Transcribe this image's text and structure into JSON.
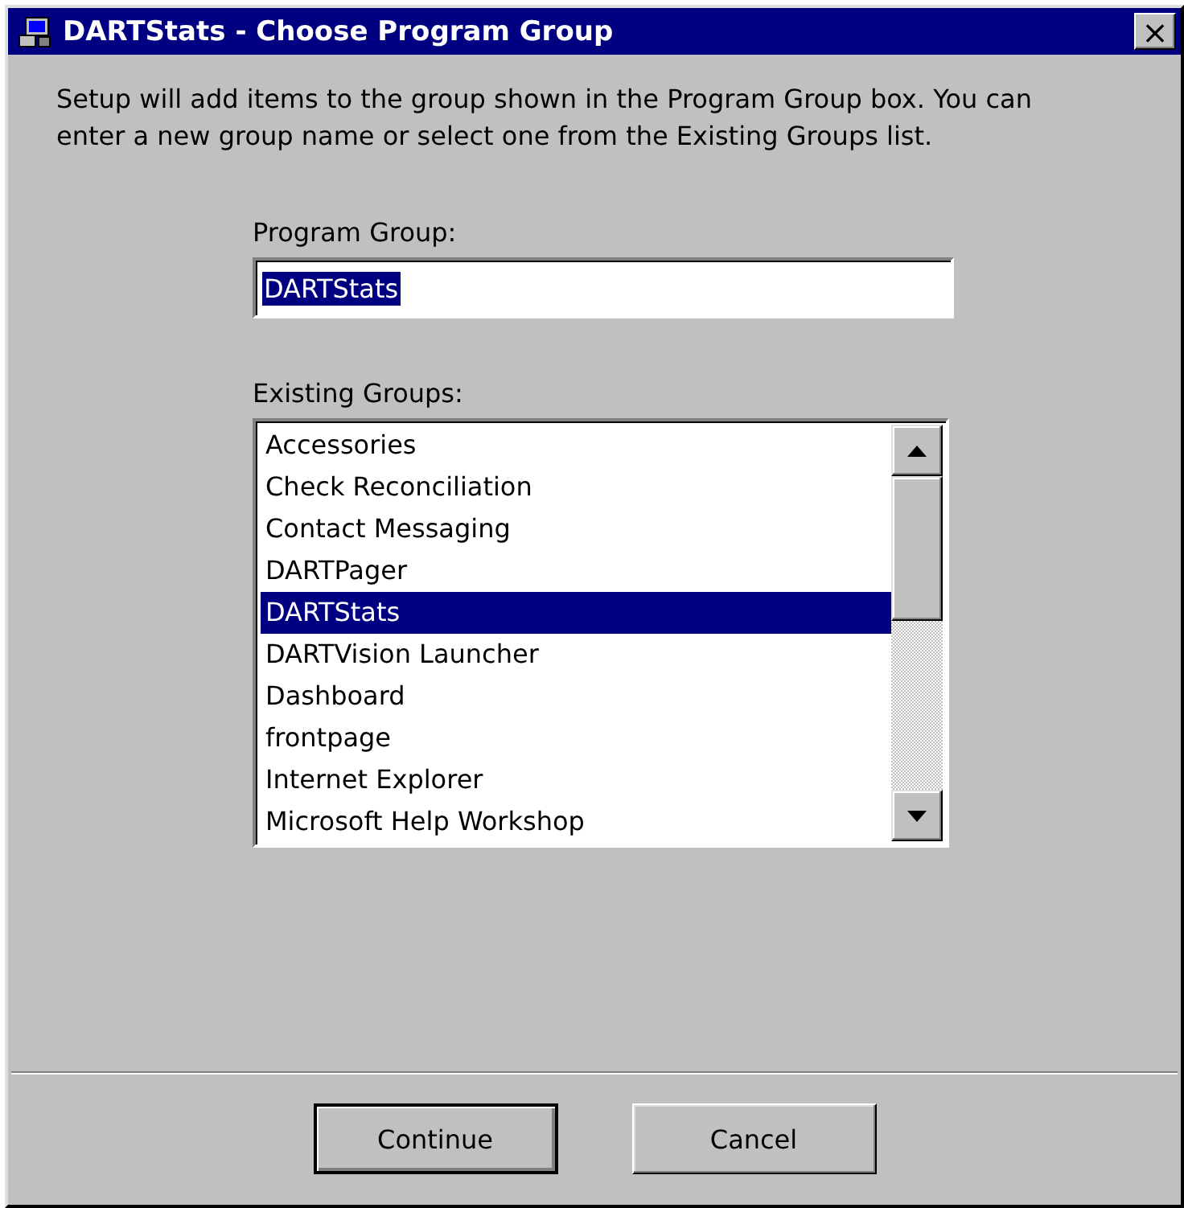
{
  "window": {
    "title": "DARTStats - Choose Program Group",
    "close": "×"
  },
  "intro": "Setup will add items to the group shown in the Program Group box. You can enter a new group name or select one from the Existing Groups list.",
  "program_group": {
    "label": "Program Group:",
    "value": "DARTStats"
  },
  "existing_groups": {
    "label": "Existing Groups:",
    "items": [
      {
        "name": "Accessories",
        "selected": false
      },
      {
        "name": "Check Reconciliation",
        "selected": false
      },
      {
        "name": "Contact Messaging",
        "selected": false
      },
      {
        "name": "DARTPager",
        "selected": false
      },
      {
        "name": "DARTStats",
        "selected": true
      },
      {
        "name": "DARTVision Launcher",
        "selected": false
      },
      {
        "name": "Dashboard",
        "selected": false
      },
      {
        "name": "frontpage",
        "selected": false
      },
      {
        "name": "Internet Explorer",
        "selected": false
      },
      {
        "name": "Microsoft Help Workshop",
        "selected": false
      }
    ]
  },
  "buttons": [
    {
      "label": "Continue",
      "default": true
    },
    {
      "label": "Cancel",
      "default": false
    }
  ]
}
